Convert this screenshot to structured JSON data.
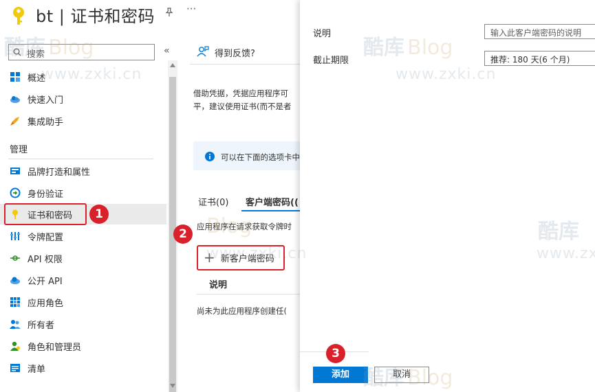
{
  "header": {
    "title": "bt | 证书和密码",
    "more": "···"
  },
  "sidebar": {
    "search_placeholder": "搜索",
    "collapse": "«",
    "items_top": [
      {
        "label": "概述",
        "icon": "grid-icon"
      },
      {
        "label": "快速入门",
        "icon": "cloud-icon"
      },
      {
        "label": "集成助手",
        "icon": "rocket-icon"
      }
    ],
    "section_title": "管理",
    "items_manage": [
      {
        "label": "品牌打造和属性",
        "icon": "branding-icon"
      },
      {
        "label": "身份验证",
        "icon": "auth-icon"
      },
      {
        "label": "证书和密码",
        "icon": "key-icon",
        "selected": true
      },
      {
        "label": "令牌配置",
        "icon": "token-icon"
      },
      {
        "label": "API 权限",
        "icon": "api-permission-icon"
      },
      {
        "label": "公开 API",
        "icon": "cloud-api-icon"
      },
      {
        "label": "应用角色",
        "icon": "app-roles-icon"
      },
      {
        "label": "所有者",
        "icon": "owners-icon"
      },
      {
        "label": "角色和管理员",
        "icon": "admin-icon"
      },
      {
        "label": "清单",
        "icon": "manifest-icon"
      }
    ]
  },
  "main": {
    "feedback": "得到反馈?",
    "desc_line1": "借助凭据，凭据应用程序可",
    "desc_line2": "平，建议使用证书(而不是者",
    "info": "可以在下面的选项卡中",
    "tabs": [
      "证书(0)",
      "客户端密码(("
    ],
    "request_text": "应用程序在请求获取令牌时",
    "new_secret_label": "新客户端密码",
    "column_header": "说明",
    "empty_text": "尚未为此应用程序创建任("
  },
  "panel": {
    "description_label": "说明",
    "description_placeholder": "输入此客户端密码的说明",
    "expiry_label": "截止期限",
    "expiry_value": "推荐: 180 天(6 个月)",
    "add_button": "添加",
    "cancel_button": "取消"
  },
  "annotations": {
    "badge1": "1",
    "badge2": "2",
    "badge3": "3"
  },
  "watermark": {
    "brand_a": "酷库",
    "brand_b": "Blog",
    "url": "www.zxki.cn"
  },
  "colors": {
    "accent": "#0078d4",
    "annotation": "#d9212c",
    "selected_bg": "#eaeaea"
  }
}
